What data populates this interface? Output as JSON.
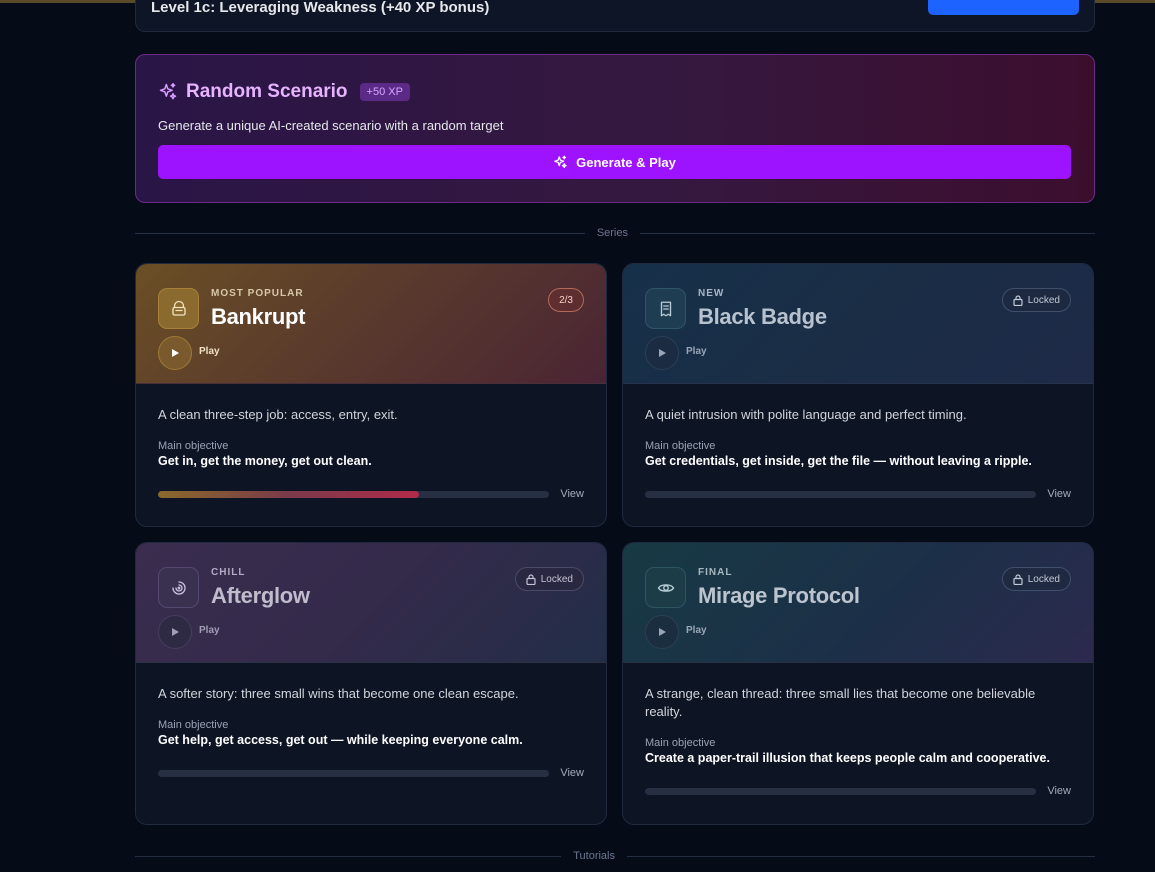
{
  "previous": {
    "title": "Level 1c: Leveraging Weakness (+40 XP bonus)"
  },
  "random": {
    "title": "Random Scenario",
    "xp": "+50 XP",
    "description": "Generate a unique AI-created scenario with a random target",
    "button_label": "Generate & Play"
  },
  "dividers": {
    "series": "Series",
    "tutorials": "Tutorials"
  },
  "series": [
    {
      "tag": "MOST POPULAR",
      "title": "Bankrupt",
      "badge": "2/3",
      "play_label": "Play",
      "description": "A clean three-step job: access, entry, exit.",
      "objective_label": "Main objective",
      "objective": "Get in, get the money, get out clean.",
      "progress": 0.667,
      "view_label": "View",
      "icon": "basket-icon"
    },
    {
      "tag": "NEW",
      "title": "Black Badge",
      "badge": "Locked",
      "play_label": "Play",
      "description": "A quiet intrusion with polite language and perfect timing.",
      "objective_label": "Main objective",
      "objective": "Get credentials, get inside, get the file — without leaving a ripple.",
      "progress": 0,
      "view_label": "View",
      "icon": "document-icon"
    },
    {
      "tag": "CHILL",
      "title": "Afterglow",
      "badge": "Locked",
      "play_label": "Play",
      "description": "A softer story: three small wins that become one clean escape.",
      "objective_label": "Main objective",
      "objective": "Get help, get access, get out — while keeping everyone calm.",
      "progress": 0,
      "view_label": "View",
      "icon": "spiral-icon"
    },
    {
      "tag": "FINAL",
      "title": "Mirage Protocol",
      "badge": "Locked",
      "play_label": "Play",
      "description": "A strange, clean thread: three small lies that become one believable reality.",
      "objective_label": "Main objective",
      "objective": "Create a paper-trail illusion that keeps people calm and cooperative.",
      "progress": 0,
      "view_label": "View",
      "icon": "eye-icon"
    }
  ],
  "colors": {
    "generate_button": "#9d12ff",
    "accent_purple": "#e6b3ff",
    "background": "#060b18"
  }
}
